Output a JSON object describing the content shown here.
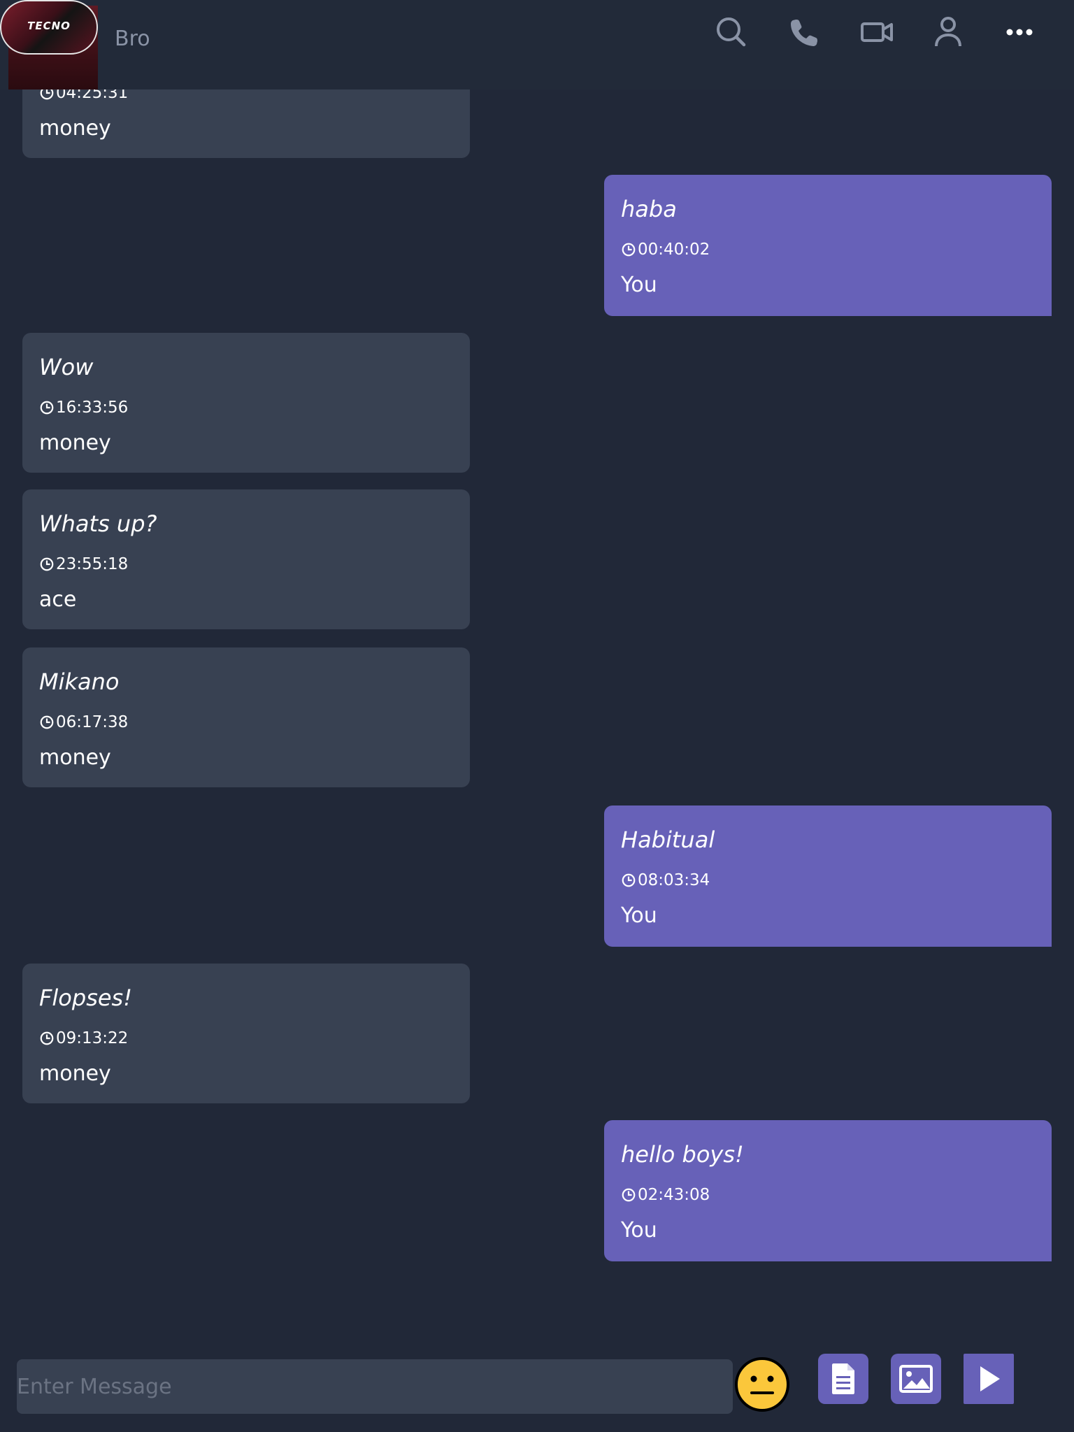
{
  "header": {
    "avatar_logo": "TECNO",
    "contact_name": "Bro",
    "icons": [
      "search-icon",
      "phone-icon",
      "video-icon",
      "user-icon",
      "more-icon"
    ]
  },
  "messages": [
    {
      "direction": "in",
      "text": "",
      "time": "04:25:31",
      "sender": "money"
    },
    {
      "direction": "out",
      "text": "haba",
      "time": "00:40:02",
      "sender": "You"
    },
    {
      "direction": "in",
      "text": "Wow",
      "time": "16:33:56",
      "sender": "money"
    },
    {
      "direction": "in",
      "text": "Whats up?",
      "time": "23:55:18",
      "sender": "ace"
    },
    {
      "direction": "in",
      "text": "Mikano",
      "time": "06:17:38",
      "sender": "money"
    },
    {
      "direction": "out",
      "text": "Habitual",
      "time": "08:03:34",
      "sender": "You"
    },
    {
      "direction": "in",
      "text": "Flopses!",
      "time": "09:13:22",
      "sender": "money"
    },
    {
      "direction": "out",
      "text": "hello boys!",
      "time": "02:43:08",
      "sender": "You"
    }
  ],
  "composer": {
    "placeholder": "Enter Message",
    "value": ""
  },
  "colors": {
    "background": "#212838",
    "incoming_bubble": "#384152",
    "outgoing_bubble": "#6761b8",
    "icon": "#8a93a6"
  }
}
